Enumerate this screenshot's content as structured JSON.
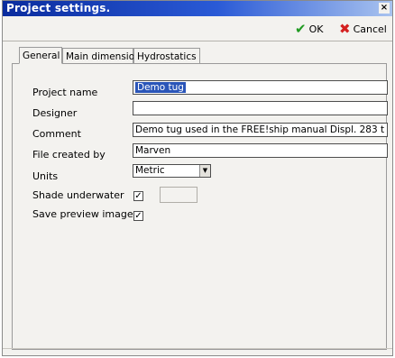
{
  "window": {
    "title": "Project settings.",
    "close_label": "×"
  },
  "toolbar": {
    "ok_label": "OK",
    "ok_icon": "checkmark-icon",
    "ok_icon_color": "#1f9a21",
    "cancel_label": "Cancel",
    "cancel_icon": "red-x-icon",
    "cancel_icon_color": "#d42020"
  },
  "tabs": [
    {
      "label": "General",
      "active": true
    },
    {
      "label": "Main dimensions",
      "active": false
    },
    {
      "label": "Hydrostatics",
      "active": false
    }
  ],
  "form": {
    "project_name": {
      "label": "Project name",
      "value": "Demo tug"
    },
    "designer": {
      "label": "Designer",
      "value": ""
    },
    "comment": {
      "label": "Comment",
      "value": "Demo tug used in the FREE!ship manual Displ. 283 t"
    },
    "file_created_by": {
      "label": "File created by",
      "value": "Marven"
    },
    "units": {
      "label": "Units",
      "value": "Metric"
    },
    "shade_underwater": {
      "label": "Shade underwater",
      "checked": true,
      "mark": "✓"
    },
    "save_preview_image": {
      "label": "Save preview image",
      "checked": true,
      "mark": "✓"
    }
  },
  "colors": {
    "titlebar": "#0a2c9e",
    "selection": "#2a55b8"
  }
}
